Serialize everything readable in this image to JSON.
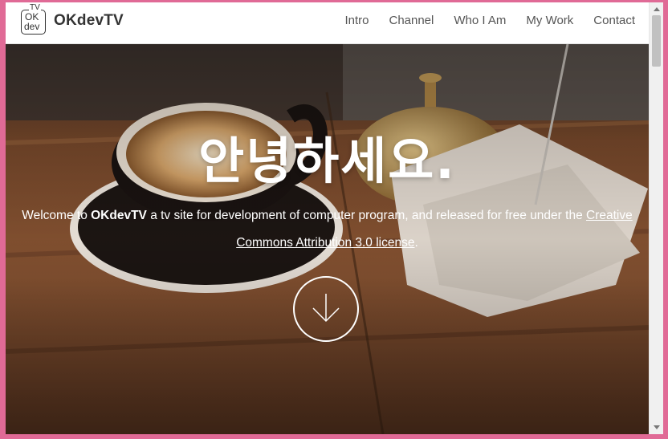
{
  "brand": {
    "logo_top": "TV",
    "logo_line1": "OK",
    "logo_line2": "dev",
    "name": "OKdevTV"
  },
  "nav": {
    "items": [
      {
        "label": "Intro"
      },
      {
        "label": "Channel"
      },
      {
        "label": "Who I Am"
      },
      {
        "label": "My Work"
      },
      {
        "label": "Contact"
      }
    ]
  },
  "hero": {
    "headline": "안녕하세요.",
    "lead_prefix": "Welcome to ",
    "lead_brand": "OKdevTV",
    "lead_middle": " a tv site for development of computer program, and released for free under the ",
    "lead_link": "Creative Commons Attribution 3.0 license",
    "lead_suffix": ".",
    "down_button_icon": "arrow-down-icon"
  },
  "colors": {
    "page_border": "#e06a96",
    "nav_text": "#555555",
    "brand_text": "#333333",
    "hero_text": "#ffffff"
  }
}
